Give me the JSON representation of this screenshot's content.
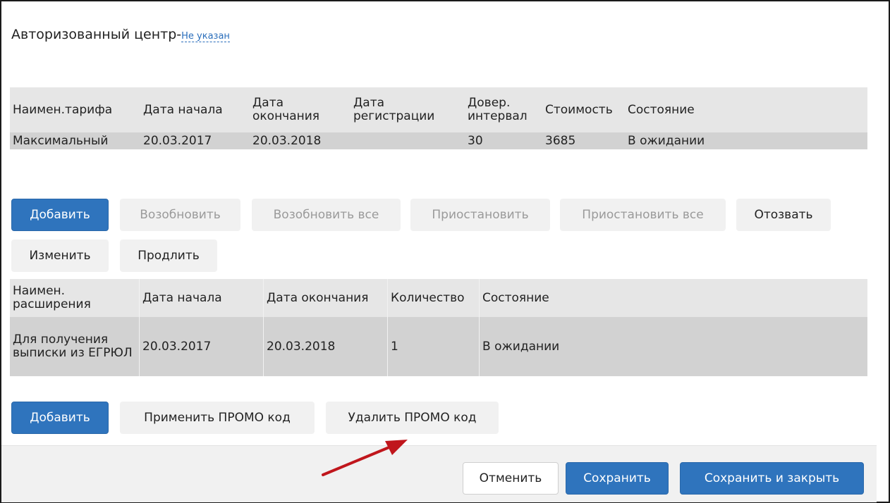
{
  "center": {
    "label": "Авторизованный центр-",
    "value_link": "Не указан"
  },
  "tariffs": {
    "headers": [
      "Наимен.тарифа",
      "Дата начала",
      "Дата окончания",
      "Дата регистрации",
      "Довер. интервал",
      "Стоимость",
      "Состояние"
    ],
    "rows": [
      [
        "Максимальный",
        "20.03.2017",
        "20.03.2018",
        "",
        "30",
        "3685",
        "В ожидании"
      ]
    ]
  },
  "tariff_actions": {
    "add": "Добавить",
    "resume": "Возобновить",
    "resume_all": "Возобновить все",
    "suspend": "Приостановить",
    "suspend_all": "Приостановить все",
    "revoke": "Отозвать",
    "edit": "Изменить",
    "extend": "Продлить"
  },
  "extensions": {
    "headers": [
      "Наимен. расширения",
      "Дата начала",
      "Дата окончания",
      "Количество",
      "Состояние"
    ],
    "rows": [
      [
        "Для получения выписки из ЕГРЮЛ",
        "20.03.2017",
        "20.03.2018",
        "1",
        "В ожидании"
      ]
    ]
  },
  "extension_actions": {
    "add": "Добавить",
    "apply_promo": "Применить ПРОМО код",
    "delete_promo": "Удалить ПРОМО код"
  },
  "footer": {
    "cancel": "Отменить",
    "save": "Сохранить",
    "save_close": "Сохранить и закрыть"
  },
  "colors": {
    "primary": "#2f74bd",
    "arrow": "#c0161c"
  }
}
